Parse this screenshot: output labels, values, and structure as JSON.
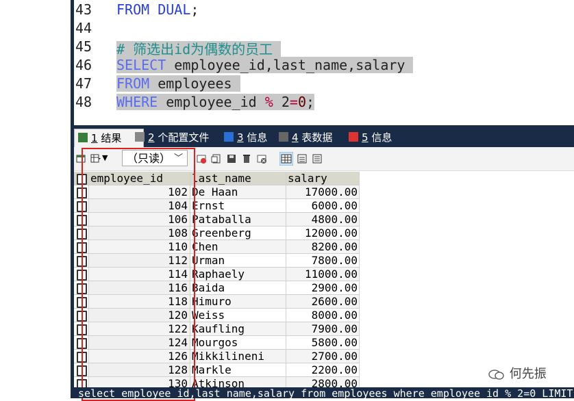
{
  "editor": {
    "lines": [
      {
        "n": "43",
        "parts": [
          [
            "kw",
            "FROM"
          ],
          [
            "t",
            " "
          ],
          [
            "kw",
            "DUAL"
          ],
          [
            "t",
            ";"
          ]
        ],
        "selected": false
      },
      {
        "n": "44",
        "parts": [],
        "selected": false
      },
      {
        "n": "45",
        "parts": [
          [
            "cm",
            "# 筛选出id为偶数的员工 "
          ]
        ],
        "selected": true
      },
      {
        "n": "46",
        "parts": [
          [
            "kw",
            "SELECT"
          ],
          [
            "t",
            " employee_id,last_name,salary "
          ]
        ],
        "selected": true
      },
      {
        "n": "47",
        "parts": [
          [
            "kw",
            "FROM"
          ],
          [
            "t",
            " employees "
          ]
        ],
        "selected": true
      },
      {
        "n": "48",
        "parts": [
          [
            "kw",
            "WHERE"
          ],
          [
            "t",
            " employee_id "
          ],
          [
            "op",
            "%"
          ],
          [
            "t",
            " 2"
          ],
          [
            "op",
            "="
          ],
          [
            "nm",
            "0"
          ],
          [
            "t",
            ";"
          ]
        ],
        "selected": true
      }
    ]
  },
  "tabs": [
    {
      "num": "1",
      "label": " 结果",
      "active": true
    },
    {
      "num": "2",
      "label": " 个配置文件",
      "active": false
    },
    {
      "num": "3",
      "label": " 信息",
      "active": false
    },
    {
      "num": "4",
      "label": " 表数据",
      "active": false
    },
    {
      "num": "5",
      "label": " 信息",
      "active": false
    }
  ],
  "toolbar": {
    "readonly_label": "（只读）"
  },
  "chart_data": {
    "type": "table",
    "columns": [
      "employee_id",
      "last_name",
      "salary"
    ],
    "rows": [
      [
        "102",
        "De Haan",
        "17000.00"
      ],
      [
        "104",
        "Ernst",
        "6000.00"
      ],
      [
        "106",
        "Pataballa",
        "4800.00"
      ],
      [
        "108",
        "Greenberg",
        "12000.00"
      ],
      [
        "110",
        "Chen",
        "8200.00"
      ],
      [
        "112",
        "Urman",
        "7800.00"
      ],
      [
        "114",
        "Raphaely",
        "11000.00"
      ],
      [
        "116",
        "Baida",
        "2900.00"
      ],
      [
        "118",
        "Himuro",
        "2600.00"
      ],
      [
        "120",
        "Weiss",
        "8000.00"
      ],
      [
        "122",
        "Kaufling",
        "7900.00"
      ],
      [
        "124",
        "Mourgos",
        "5800.00"
      ],
      [
        "126",
        "Mikkilineni",
        "2700.00"
      ],
      [
        "128",
        "Markle",
        "2200.00"
      ],
      [
        "130",
        "Atkinson",
        "2800.00"
      ]
    ]
  },
  "status": {
    "text": "select employee_id,last_name,salary from employees where employee_id % 2=0 LIMIT"
  },
  "watermark": {
    "text": "何先振"
  },
  "colors": {
    "accent_red": "#e02020",
    "dark_bar": "#1a2b47",
    "keyword": "#2a3ed8",
    "comment": "#1f8f8f"
  }
}
